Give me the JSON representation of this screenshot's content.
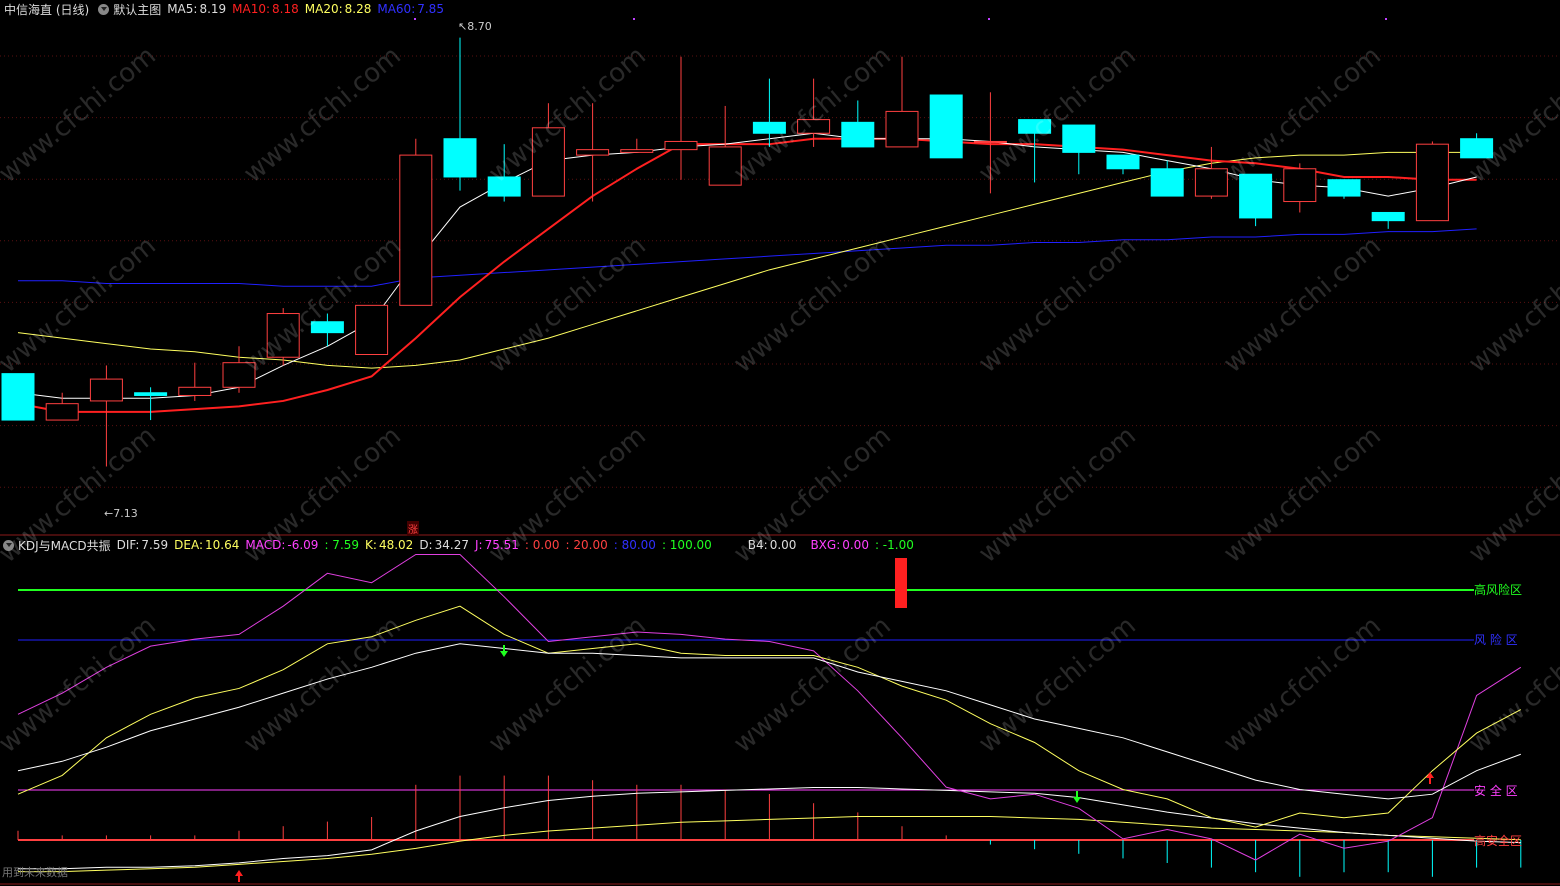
{
  "header": {
    "stock": "中信海直 (日线)",
    "template": "默认主图",
    "ma5_label": "MA5:",
    "ma5": "8.19",
    "ma10_label": "MA10:",
    "ma10": "8.18",
    "ma20_label": "MA20:",
    "ma20": "8.28",
    "ma60_label": "MA60:",
    "ma60": "7.85"
  },
  "indicator": {
    "name": "KDJ与MACD共振",
    "dif_label": "DIF:",
    "dif": "7.59",
    "dea_label": "DEA:",
    "dea": "10.64",
    "macd_label": "MACD:",
    "macd": "-6.09",
    "v1": ": 7.59",
    "k_label": "K:",
    "k": "48.02",
    "d_label": "D:",
    "d": "34.27",
    "j_label": "J:",
    "j": "75.51",
    "z1": ": 0.00",
    "z2": ": 20.00",
    "z3": ": 80.00",
    "z4": ": 100.00",
    "b4_label": "B4:",
    "b4": "0.00",
    "bxg_label": "BXG:",
    "bxg": "0.00",
    "bxg2": ": -1.00"
  },
  "annotations": {
    "high": "8.70",
    "low": "7.13",
    "zhang": "涨"
  },
  "zones": {
    "high_risk": "高风险区",
    "risk": "风 险 区",
    "safe": "安 全 区",
    "high_safe": "高安全区"
  },
  "footer": {
    "note": "用到未来数据"
  },
  "watermark": "www.cfchi.com",
  "colors": {
    "up": "#ff4040",
    "down": "#00ffff",
    "ma5": "#ffffff",
    "ma10": "#ff2020",
    "ma20": "#ffff60",
    "ma60": "#2020ff"
  },
  "chart_data": {
    "type": "candlestick",
    "price_range": [
      7.0,
      8.75
    ],
    "candles": [
      {
        "o": 7.47,
        "h": 7.47,
        "l": 7.3,
        "c": 7.3
      },
      {
        "o": 7.3,
        "h": 7.4,
        "l": 7.3,
        "c": 7.36
      },
      {
        "o": 7.37,
        "h": 7.5,
        "l": 7.13,
        "c": 7.45
      },
      {
        "o": 7.4,
        "h": 7.42,
        "l": 7.3,
        "c": 7.39
      },
      {
        "o": 7.39,
        "h": 7.51,
        "l": 7.37,
        "c": 7.42
      },
      {
        "o": 7.42,
        "h": 7.57,
        "l": 7.4,
        "c": 7.51
      },
      {
        "o": 7.53,
        "h": 7.71,
        "l": 7.5,
        "c": 7.69
      },
      {
        "o": 7.66,
        "h": 7.69,
        "l": 7.57,
        "c": 7.62
      },
      {
        "o": 7.54,
        "h": 7.72,
        "l": 7.54,
        "c": 7.72
      },
      {
        "o": 7.72,
        "h": 8.33,
        "l": 7.72,
        "c": 8.27
      },
      {
        "o": 8.33,
        "h": 8.7,
        "l": 8.14,
        "c": 8.19
      },
      {
        "o": 8.19,
        "h": 8.31,
        "l": 8.1,
        "c": 8.12
      },
      {
        "o": 8.12,
        "h": 8.46,
        "l": 8.12,
        "c": 8.37
      },
      {
        "o": 8.27,
        "h": 8.46,
        "l": 8.1,
        "c": 8.29
      },
      {
        "o": 8.28,
        "h": 8.33,
        "l": 8.28,
        "c": 8.29
      },
      {
        "o": 8.29,
        "h": 8.63,
        "l": 8.18,
        "c": 8.32
      },
      {
        "o": 8.16,
        "h": 8.45,
        "l": 8.16,
        "c": 8.3
      },
      {
        "o": 8.39,
        "h": 8.55,
        "l": 8.3,
        "c": 8.35
      },
      {
        "o": 8.35,
        "h": 8.55,
        "l": 8.3,
        "c": 8.4
      },
      {
        "o": 8.39,
        "h": 8.47,
        "l": 8.3,
        "c": 8.3
      },
      {
        "o": 8.3,
        "h": 8.63,
        "l": 8.3,
        "c": 8.43
      },
      {
        "o": 8.49,
        "h": 8.49,
        "l": 8.26,
        "c": 8.26
      },
      {
        "o": 8.32,
        "h": 8.5,
        "l": 8.13,
        "c": 8.32
      },
      {
        "o": 8.4,
        "h": 8.4,
        "l": 8.17,
        "c": 8.35
      },
      {
        "o": 8.38,
        "h": 8.38,
        "l": 8.2,
        "c": 8.28
      },
      {
        "o": 8.27,
        "h": 8.27,
        "l": 8.2,
        "c": 8.22
      },
      {
        "o": 8.22,
        "h": 8.25,
        "l": 8.12,
        "c": 8.12
      },
      {
        "o": 8.12,
        "h": 8.3,
        "l": 8.11,
        "c": 8.22
      },
      {
        "o": 8.2,
        "h": 8.2,
        "l": 8.01,
        "c": 8.04
      },
      {
        "o": 8.1,
        "h": 8.24,
        "l": 8.06,
        "c": 8.22
      },
      {
        "o": 8.18,
        "h": 8.18,
        "l": 8.11,
        "c": 8.12
      },
      {
        "o": 8.06,
        "h": 8.06,
        "l": 8.0,
        "c": 8.03
      },
      {
        "o": 8.03,
        "h": 8.32,
        "l": 8.03,
        "c": 8.31
      },
      {
        "o": 8.33,
        "h": 8.35,
        "l": 8.26,
        "c": 8.26
      }
    ],
    "ma5": [
      7.4,
      7.38,
      7.38,
      7.38,
      7.39,
      7.42,
      7.5,
      7.57,
      7.66,
      7.88,
      8.08,
      8.17,
      8.25,
      8.27,
      8.28,
      8.3,
      8.31,
      8.33,
      8.35,
      8.33,
      8.33,
      8.33,
      8.32,
      8.3,
      8.29,
      8.28,
      8.25,
      8.22,
      8.18,
      8.16,
      8.15,
      8.12,
      8.15,
      8.19
    ],
    "ma10": [
      7.36,
      7.33,
      7.33,
      7.33,
      7.34,
      7.35,
      7.37,
      7.41,
      7.46,
      7.6,
      7.75,
      7.88,
      8.0,
      8.12,
      8.22,
      8.31,
      8.31,
      8.31,
      8.33,
      8.33,
      8.33,
      8.32,
      8.31,
      8.31,
      8.3,
      8.29,
      8.27,
      8.25,
      8.24,
      8.22,
      8.19,
      8.19,
      8.18,
      8.18
    ],
    "ma20": [
      7.62,
      7.6,
      7.58,
      7.56,
      7.55,
      7.53,
      7.52,
      7.5,
      7.49,
      7.5,
      7.52,
      7.56,
      7.6,
      7.65,
      7.7,
      7.75,
      7.8,
      7.85,
      7.89,
      7.93,
      7.97,
      8.01,
      8.05,
      8.09,
      8.13,
      8.17,
      8.21,
      8.24,
      8.26,
      8.27,
      8.27,
      8.28,
      8.28,
      8.28
    ],
    "ma60": [
      7.81,
      7.81,
      7.8,
      7.8,
      7.8,
      7.8,
      7.79,
      7.79,
      7.79,
      7.82,
      7.83,
      7.84,
      7.85,
      7.86,
      7.87,
      7.88,
      7.89,
      7.9,
      7.91,
      7.92,
      7.93,
      7.94,
      7.94,
      7.95,
      7.95,
      7.96,
      7.96,
      7.97,
      7.97,
      7.98,
      7.98,
      7.99,
      7.99,
      8.0
    ],
    "kdj_j": [
      62,
      71,
      82,
      91,
      94,
      96,
      108,
      122,
      118,
      131,
      136,
      112,
      93,
      95,
      97,
      96,
      94,
      93,
      89,
      72,
      52,
      31,
      26,
      28,
      22,
      9,
      13,
      9,
      0,
      11,
      5,
      8,
      18,
      70,
      82
    ],
    "kdj_k": [
      28,
      36,
      52,
      62,
      69,
      73,
      81,
      92,
      95,
      102,
      108,
      96,
      88,
      90,
      92,
      88,
      87,
      87,
      87,
      82,
      74,
      68,
      58,
      50,
      38,
      30,
      26,
      18,
      14,
      20,
      18,
      20,
      38,
      54,
      64
    ],
    "kdj_d": [
      38,
      42,
      48,
      55,
      60,
      65,
      71,
      77,
      82,
      88,
      92,
      90,
      88,
      88,
      87,
      86,
      86,
      86,
      86,
      80,
      76,
      72,
      66,
      60,
      56,
      52,
      46,
      40,
      34,
      30,
      28,
      26,
      28,
      38,
      45
    ],
    "bottom_yellow": [
      -8,
      -8,
      -7,
      -6,
      -5,
      -3,
      -1,
      1,
      4,
      8,
      13,
      17,
      20,
      22,
      24,
      26,
      27,
      28,
      29,
      30,
      30,
      30,
      30,
      29,
      28,
      26,
      24,
      22,
      21,
      20,
      19,
      17,
      16,
      15,
      14
    ],
    "bottom_white": [
      -6,
      -6,
      -5,
      -5,
      -4,
      -2,
      1,
      3,
      7,
      20,
      30,
      36,
      41,
      44,
      46,
      47,
      48,
      49,
      50,
      50,
      49,
      48,
      47,
      46,
      43,
      38,
      33,
      29,
      25,
      22,
      19,
      17,
      15,
      13,
      12
    ],
    "macd_bars": [
      2,
      1,
      1,
      1,
      1,
      2,
      3,
      4,
      5,
      12,
      14,
      14,
      14,
      13,
      12,
      12,
      11,
      10,
      8,
      6,
      3,
      1,
      -1,
      -2,
      -3,
      -4,
      -5,
      -6,
      -7,
      -8,
      -7,
      -7,
      -8,
      -6,
      -6
    ],
    "signal_bar_value": 1
  }
}
